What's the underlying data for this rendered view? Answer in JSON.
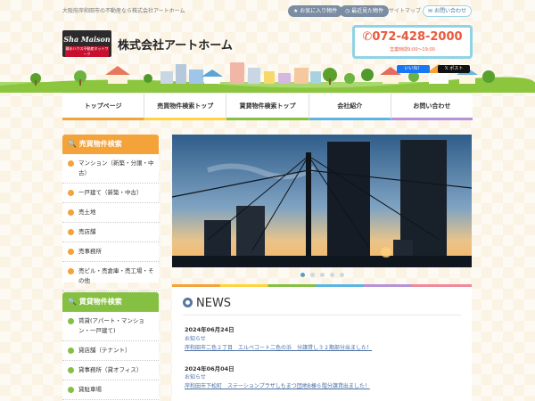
{
  "header": {
    "tagline": "大阪府岸和田市の不動産なら株式会社アートホーム",
    "favorites_label": "お気に入り物件",
    "recent_label": "最近見た物件",
    "sitemap_label": "サイトマップ",
    "contact_label": "お問い合わせ",
    "logo_text": "Sha Maison",
    "logo_subtext": "積水ハウス不動産ネットワーク",
    "company_name": "株式会社アートホーム",
    "phone": "072-428-2000",
    "hours": "営業時間9:00～19:00",
    "like_label": "いいね！",
    "post_label": "ポスト"
  },
  "nav": {
    "items": [
      {
        "label": "トップページ",
        "color": "#f4a23a"
      },
      {
        "label": "売買物件検索トップ",
        "color": "#ffd23f"
      },
      {
        "label": "賃貸物件検索トップ",
        "color": "#86c043"
      },
      {
        "label": "会社紹介",
        "color": "#5bb5e3"
      },
      {
        "label": "お問い合わせ",
        "color": "#b692d8"
      }
    ]
  },
  "sidebar_sale": {
    "title": "売買物件検索",
    "items": [
      {
        "label": "マンション（新築・分譲・中古）"
      },
      {
        "label": "一戸建て（新築・中古）"
      },
      {
        "label": "売土地"
      },
      {
        "label": "売店舗"
      },
      {
        "label": "売事務所"
      },
      {
        "label": "売ビル・売倉庫・売工場・その他"
      }
    ]
  },
  "sidebar_rent": {
    "title": "賃貸物件検索",
    "items": [
      {
        "label": "賃貸(アパート・マンション・一戸建て)"
      },
      {
        "label": "貸店舗（テナント）"
      },
      {
        "label": "貸事務所（貸オフィス）"
      },
      {
        "label": "貸駐車場"
      }
    ]
  },
  "slider": {
    "slide_count": 5,
    "active_index": 0
  },
  "news": {
    "title": "NEWS",
    "items": [
      {
        "date": "2024年06月24日",
        "category": "お知らせ",
        "text": "岸和田市二色２丁目　エルベコート二色の浜　分譲貸し３２期部分出ました！"
      },
      {
        "date": "2024年06月04日",
        "category": "お知らせ",
        "text": "岸和田市下松町　ステーションプラザしもまつ団地B棟６階分譲貸出ました！"
      }
    ]
  },
  "colors": {
    "accent_orange": "#f4a23a",
    "accent_green": "#86c043",
    "phone_red": "#e85a3c",
    "header_blue": "#8fd3e6"
  }
}
